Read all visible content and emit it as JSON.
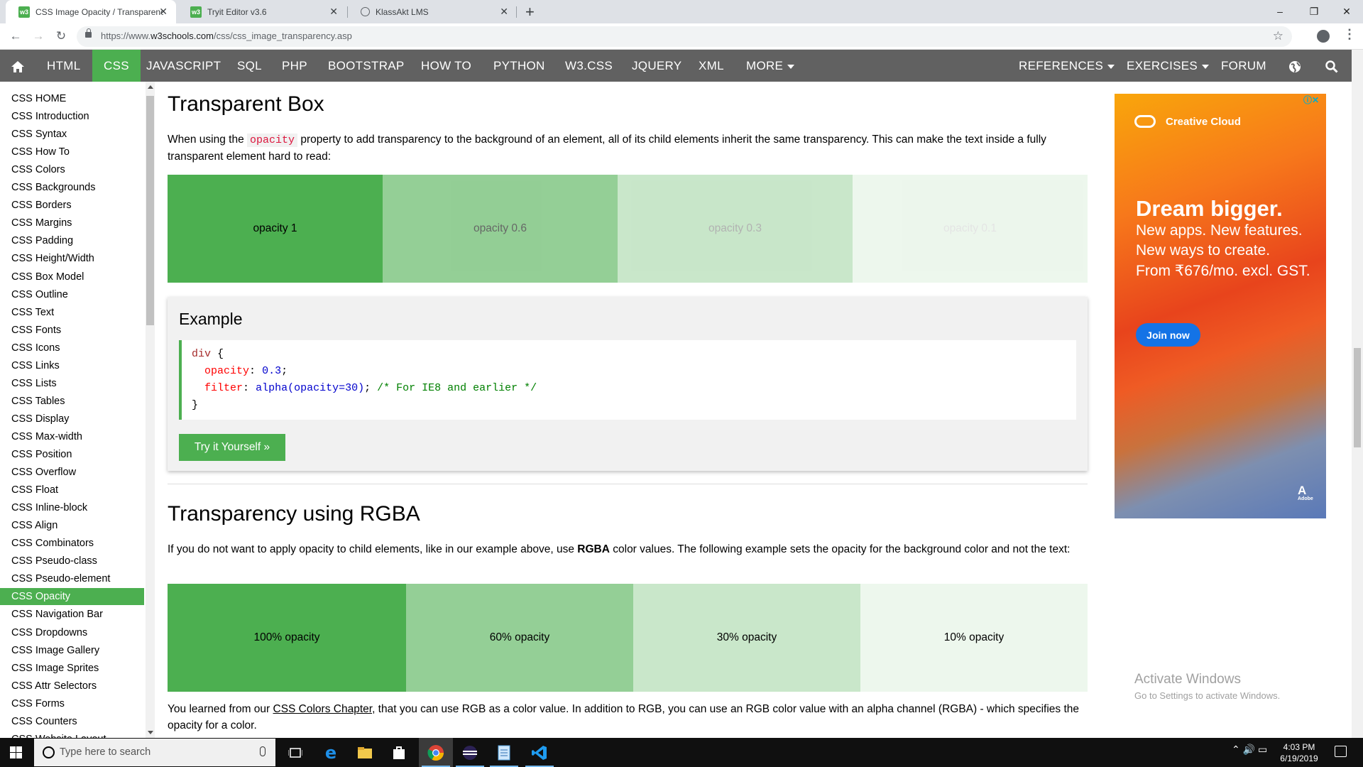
{
  "browser": {
    "tabs": [
      {
        "title": "CSS Image Opacity / Transparenc",
        "active": true
      },
      {
        "title": "Tryit Editor v3.6",
        "active": false
      },
      {
        "title": "KlassAkt LMS",
        "active": false
      }
    ],
    "new_tab": "+",
    "url_prefix": "https://www.",
    "url_host": "w3schools.com",
    "url_path": "/css/css_image_transparency.asp",
    "window_controls": {
      "minimize": "–",
      "restore": "❐",
      "close": "✕"
    }
  },
  "topnav": {
    "home_icon": "home-icon",
    "items": [
      "HTML",
      "CSS",
      "JAVASCRIPT",
      "SQL",
      "PHP",
      "BOOTSTRAP",
      "HOW TO",
      "PYTHON",
      "W3.CSS",
      "JQUERY",
      "XML",
      "MORE"
    ],
    "right_items": [
      "REFERENCES",
      "EXERCISES",
      "FORUM"
    ],
    "active": "CSS",
    "accent": "#4caf50"
  },
  "sidebar": {
    "items": [
      "CSS HOME",
      "CSS Introduction",
      "CSS Syntax",
      "CSS How To",
      "CSS Colors",
      "CSS Backgrounds",
      "CSS Borders",
      "CSS Margins",
      "CSS Padding",
      "CSS Height/Width",
      "CSS Box Model",
      "CSS Outline",
      "CSS Text",
      "CSS Fonts",
      "CSS Icons",
      "CSS Links",
      "CSS Lists",
      "CSS Tables",
      "CSS Display",
      "CSS Max-width",
      "CSS Position",
      "CSS Overflow",
      "CSS Float",
      "CSS Inline-block",
      "CSS Align",
      "CSS Combinators",
      "CSS Pseudo-class",
      "CSS Pseudo-element",
      "CSS Opacity",
      "CSS Navigation Bar",
      "CSS Dropdowns",
      "CSS Image Gallery",
      "CSS Image Sprites",
      "CSS Attr Selectors",
      "CSS Forms",
      "CSS Counters",
      "CSS Website Layout"
    ],
    "active_index": 28
  },
  "main": {
    "section1": {
      "title": "Transparent Box",
      "para_before": "When using the",
      "para_code": "opacity",
      "para_after": "property to add transparency to the background of an element, all of its child elements inherit the same transparency. This can make the text inside a fully transparent element hard to read:",
      "boxes": [
        {
          "label": "opacity 1",
          "opacity": 1
        },
        {
          "label": "opacity 0.6",
          "opacity": 0.6
        },
        {
          "label": "opacity 0.3",
          "opacity": 0.3
        },
        {
          "label": "opacity 0.1",
          "opacity": 0.1
        }
      ]
    },
    "example": {
      "heading": "Example",
      "code_selector": "div",
      "code_open": "{",
      "code_close": "}",
      "line1_prop": "opacity",
      "line1_val": "0.3",
      "line2_prop": "filter",
      "line2_val": "alpha(opacity=30)",
      "line2_comment": "/* For IE8 and earlier */",
      "try_button": "Try it Yourself »"
    },
    "section2": {
      "title": "Transparency using RGBA",
      "para_before": "If you do not want to apply opacity to child elements, like in our example above, use",
      "para_bold": "RGBA",
      "para_after": "color values. The following example sets the opacity for the background color and not the text:",
      "boxes": [
        {
          "label": "100% opacity",
          "alpha": 1
        },
        {
          "label": "60% opacity",
          "alpha": 0.6
        },
        {
          "label": "30% opacity",
          "alpha": 0.3
        },
        {
          "label": "10% opacity",
          "alpha": 0.1
        }
      ],
      "para3_before": "You learned from our",
      "para3_link": "CSS Colors Chapter",
      "para3_after": ", that you can use RGB as a color value. In addition to RGB, you can use an RGB color value with an alpha channel (RGBA) - which specifies the opacity for a color."
    }
  },
  "ad": {
    "brand": "Creative Cloud",
    "headline": "Dream bigger.",
    "line1": "New apps. New features.",
    "line2": "New ways to create.",
    "line3": "From ₹676/mo. excl. GST.",
    "button": "Join now",
    "adobe": "A",
    "adobe_small": "Adobe",
    "close_marks": "ⓘ✕"
  },
  "watermark": {
    "line1": "Activate Windows",
    "line2": "Go to Settings to activate Windows."
  },
  "taskbar": {
    "search_placeholder": "Type here to search",
    "apps": [
      "task-view-icon",
      "edge-icon",
      "file-explorer-icon",
      "store-icon",
      "chrome-icon",
      "eclipse-icon",
      "notepad-icon",
      "vscode-icon"
    ],
    "tray_glyphs": "⌃ 🔊 ▭",
    "time": "4:03 PM",
    "date": "6/19/2019"
  }
}
